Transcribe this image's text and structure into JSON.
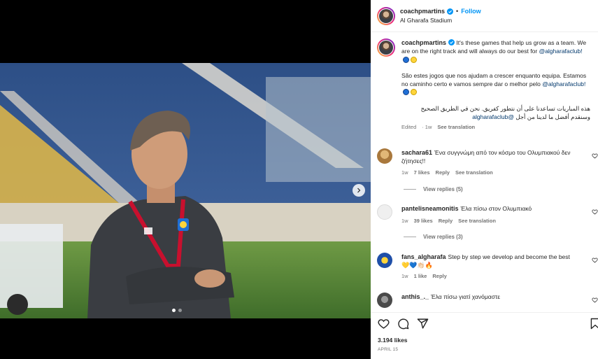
{
  "post": {
    "username": "coachpmartins",
    "follow_label": "Follow",
    "separator": "•",
    "location": "Al Gharafa Stadium",
    "media_count": 2,
    "active_media": 0
  },
  "caption": {
    "username": "coachpmartins",
    "en_text": "It's these games that help us grow as a team. We are on the right track and will always do our best for",
    "en_mention": "@algharafaclub!",
    "pt_text": "São estes jogos que nos ajudam a crescer enquanto equipa. Estamos no caminho certo e vamos sempre dar o melhor pelo",
    "pt_mention": "@algharafaclub!",
    "ar_text": "هذه المباريات تساعدنا على أن نتطور كفريق. نحن في الطريق الصحيح وسنقدم أفضل ما لدينا من أجل",
    "ar_mention": "@algharafaclub",
    "edited": "Edited",
    "time": "1w",
    "translate": "See translation",
    "club_colors": [
      "#1f6fd6",
      "#ffd43b"
    ]
  },
  "comments": [
    {
      "username": "sachara61",
      "text": "Ένα συγγνώμη από τον κόσμο του Ολυμπιακού δεν ζήτησες!!",
      "time": "1w",
      "likes": "7 likes",
      "reply": "Reply",
      "translate": "See translation",
      "replies": "View replies (5)",
      "avatar_color": "#c89a5a"
    },
    {
      "username": "pantelisneamonitis",
      "text": "Έλα πίσω στον Ολυμπιακό",
      "time": "1w",
      "likes": "39 likes",
      "reply": "Reply",
      "translate": "See translation",
      "replies": "View replies (3)",
      "avatar_color": "#dbdbdb"
    },
    {
      "username": "fans_algharafa",
      "text": "Step by step we develop and become the best",
      "emoji": "💛💙👏🏻🔥",
      "time": "1w",
      "likes": "1 like",
      "reply": "Reply",
      "avatar_color": "#1f4fa8"
    },
    {
      "username": "anthis_._",
      "text": "Έλα πίσω γιατί χανόμαστε",
      "avatar_color": "#6b6b6b"
    }
  ],
  "actions": {
    "likes": "3.194 likes",
    "date": "APRIL 15"
  },
  "icons": [
    "heart-icon",
    "comment-icon",
    "share-icon",
    "bookmark-icon",
    "verified-badge-icon",
    "chevron-right-icon"
  ]
}
